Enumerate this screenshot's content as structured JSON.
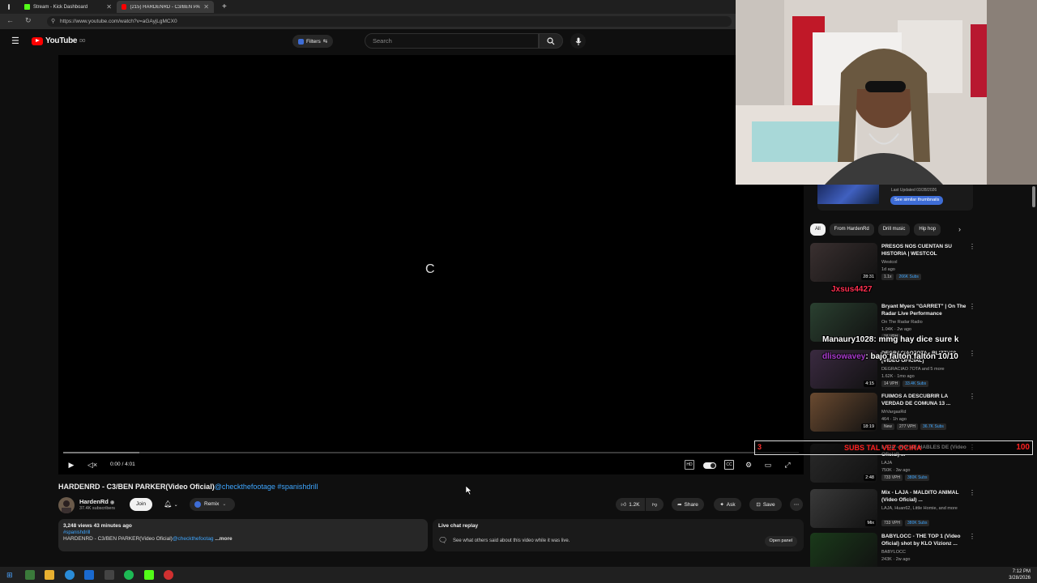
{
  "browser": {
    "tabs": [
      {
        "label": "Stream - Kick Dashboard",
        "icon": "kick-icon",
        "active": false
      },
      {
        "label": "(215) HARDENRD - C3/BEN PARK",
        "icon": "youtube-icon",
        "active": true
      }
    ],
    "url": "https://www.youtube.com/watch?v=aGAyjLgMCX0"
  },
  "yt": {
    "logo": "YouTube",
    "logo_sup": "DO",
    "filters_label": "Filters",
    "search_placeholder": "Search"
  },
  "player": {
    "time": "0:00 / 4:01",
    "buffered_fraction": 0.103
  },
  "video": {
    "title": "HARDENRD - C3/BEN PARKER(Video Oficial)",
    "title_tags": "@checkthefootage #spanishdrill",
    "channel": "HardenRd",
    "subscribers": "37.4K subscribers",
    "join_label": "Join",
    "remix_label": "Remix",
    "likes": "1.2K",
    "share_label": "Share",
    "ask_label": "Ask",
    "save_label": "Save"
  },
  "description": {
    "views_line": "3,248 views  43 minutes ago",
    "tag": "#spanishdrill",
    "body": "HARDENRD - C3/BEN PARKER(Video Oficial)",
    "body_link": "@checkthefootag",
    "more_label": "...more"
  },
  "chat_replay": {
    "title": "Live chat replay",
    "subtitle": "See what others said about this video while it was live.",
    "open_label": "Open panel"
  },
  "sidebar": {
    "banner_updated": "Last Updated 03/28/2026",
    "banner_button": "See similar thumbnails",
    "chips": [
      "All",
      "From HardenRd",
      "Drill music",
      "Hip hop"
    ],
    "videos": [
      {
        "title": "PRESOS NOS CUENTAN SU HISTORIA | WESTCOL",
        "channel": "Westcol",
        "meta": "1d ago",
        "duration": "28:31",
        "badges": [
          "1.1x",
          "266K Subs"
        ],
        "thumb": "#3a3030"
      },
      {
        "title": "Bryant Myers \"GARRET\" | On The Radar Live Performance",
        "channel": "On The Radar Radio",
        "meta": "1.04K · 2w ago",
        "duration": "",
        "badges": [
          "16 VPH"
        ],
        "thumb": "#2a4030"
      },
      {
        "title": "DEGRACIAO7OTA - BLIZZY68 [VIDEO OFICIAL]",
        "channel": "DEGRACIAO 7OTA and 5 more",
        "meta": "1.62K · 1mo ago",
        "duration": "4:15",
        "badges": [
          "14 VPH",
          "33.4K Subs"
        ],
        "thumb": "#3a2a40"
      },
      {
        "title": "FUIMOS A DESCUBRIR LA VERDAD DE COMUNA 13 ...",
        "channel": "MrVargasRd",
        "meta": "464 · 1h ago",
        "duration": "18:19",
        "badges": [
          "New",
          "277 VPH",
          "36.7K Subs"
        ],
        "thumb": "#6a4a30"
      },
      {
        "title": "LAJA - NO ME HABLES DE (Video Oficial) ...",
        "channel": "LAJA",
        "meta": "750K · 3w ago",
        "duration": "2:48",
        "badges": [
          "733 VPH",
          "380K Subs"
        ],
        "thumb": "#2a2a2a"
      },
      {
        "title": "Mix - LAJA - MALDITO ANIMAL (Video Oficial) ...",
        "channel": "LAJA, Huan62, Little Homie, and more",
        "meta": "",
        "duration": "Mix",
        "badges": [
          "733 VPH",
          "380K Subs"
        ],
        "thumb": "#3a3a3a"
      },
      {
        "title": "BABYLOCC - THE TOP 1 (Video Oficial) shot by KLO Vizionz ...",
        "channel": "BABYLOCC",
        "meta": "243K · 2w ago",
        "duration": "",
        "badges": [],
        "thumb": "#1a3a1a"
      }
    ]
  },
  "overlays": {
    "user1": "Jxsus4427",
    "chat_user": "Manaury1028",
    "chat_msg": ": mmg hay dice sure k",
    "chat_user2": "dlisowavey",
    "chat_msg2": ": bajo faltón faltón 10/10",
    "goal_current": "3",
    "goal_text": "SUBS TAL VEZ OCIRA",
    "goal_max": "100"
  },
  "taskbar": {
    "time": "7:12 PM",
    "date": "3/28/2026"
  }
}
